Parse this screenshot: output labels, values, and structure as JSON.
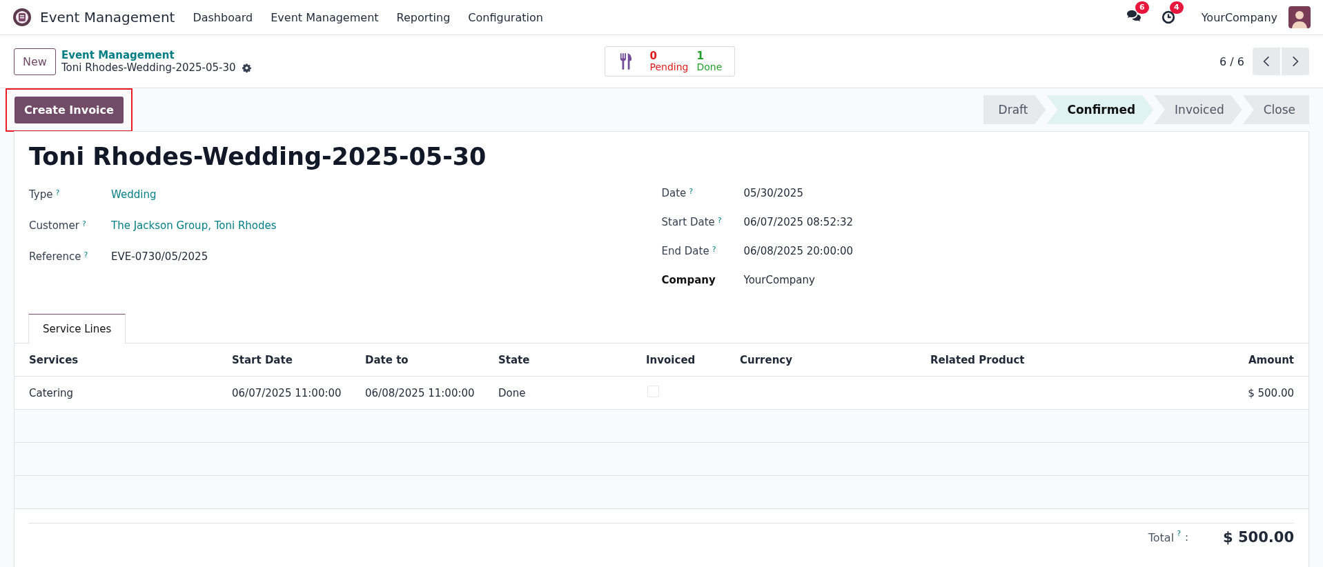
{
  "navbar": {
    "app_name": "Event Management",
    "menu": [
      "Dashboard",
      "Event Management",
      "Reporting",
      "Configuration"
    ],
    "messages_badge": "6",
    "activities_badge": "4",
    "company": "YourCompany"
  },
  "control_panel": {
    "new_button": "New",
    "breadcrumb": "Event Management",
    "record_name": "Toni Rhodes-Wedding-2025-05-30",
    "stat": {
      "pending_count": "0",
      "pending_label": "Pending",
      "done_count": "1",
      "done_label": "Done"
    },
    "pager": "6 / 6"
  },
  "actions": {
    "create_invoice": "Create Invoice",
    "highlighted": true
  },
  "statusbar": [
    {
      "label": "Draft",
      "selected": false
    },
    {
      "label": "Confirmed",
      "selected": true
    },
    {
      "label": "Invoiced",
      "selected": false
    },
    {
      "label": "Close",
      "selected": false
    }
  ],
  "form": {
    "title": "Toni Rhodes-Wedding-2025-05-30",
    "left_fields": [
      {
        "label": "Type",
        "help": "?",
        "value": "Wedding",
        "link": true,
        "required": false
      },
      {
        "label": "Customer",
        "help": "?",
        "value": "The Jackson Group, Toni Rhodes",
        "link": true,
        "required": false
      },
      {
        "label": "Reference",
        "help": "?",
        "value": "EVE-0730/05/2025",
        "link": false,
        "required": false
      }
    ],
    "right_fields": [
      {
        "label": "Date",
        "help": "?",
        "value": "05/30/2025",
        "link": false,
        "required": false
      },
      {
        "label": "Start Date",
        "help": "?",
        "value": "06/07/2025 08:52:32",
        "link": false,
        "required": false
      },
      {
        "label": "End Date",
        "help": "?",
        "value": "06/08/2025 20:00:00",
        "link": false,
        "required": false
      },
      {
        "label": "Company",
        "value": "YourCompany",
        "link": false,
        "required": true
      }
    ]
  },
  "tabs": [
    {
      "label": "Service Lines",
      "selected": true
    }
  ],
  "table": {
    "columns": [
      "Services",
      "Start Date",
      "Date to",
      "State",
      "Invoiced",
      "Currency",
      "Related Product",
      "Amount"
    ],
    "rows": [
      {
        "services": "Catering",
        "start_date": "06/07/2025 11:00:00",
        "date_to": "06/08/2025 11:00:00",
        "state": "Done",
        "invoiced": false,
        "amount": "$ 500.00"
      }
    ]
  },
  "total": {
    "label": "Total",
    "help": "?",
    "colon": ":",
    "value": "$ 500.00"
  }
}
